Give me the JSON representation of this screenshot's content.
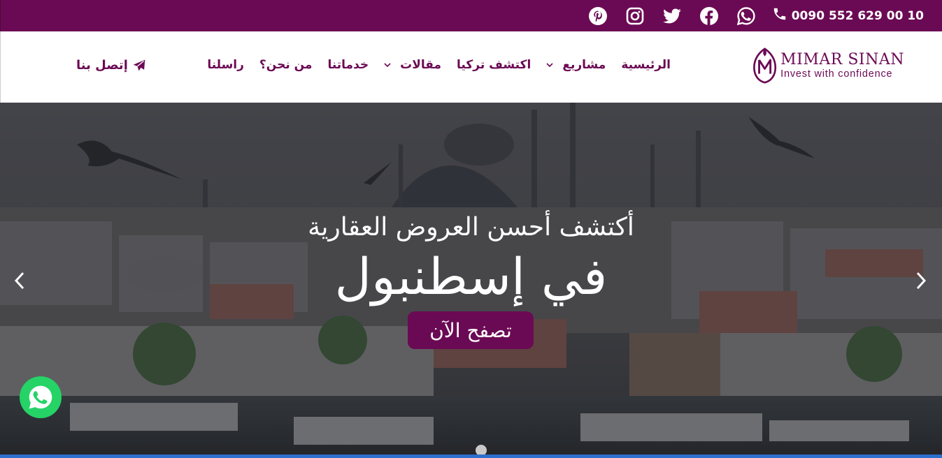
{
  "topbar": {
    "phone": "0090 552 629 00 10",
    "social_icons": [
      "whatsapp-icon",
      "facebook-icon",
      "twitter-icon",
      "instagram-icon",
      "pinterest-icon"
    ],
    "bg_color": "#6b0a54"
  },
  "logo": {
    "name": "MIMAR SINAN",
    "tagline": "Invest with confidence"
  },
  "nav": {
    "items": [
      {
        "label": "الرئيسية",
        "dropdown": false
      },
      {
        "label": "مشاريع",
        "dropdown": true
      },
      {
        "label": "اكتشف تركيا",
        "dropdown": false
      },
      {
        "label": "مقالات",
        "dropdown": true
      },
      {
        "label": "خدماتنا",
        "dropdown": false
      },
      {
        "label": "من نحن؟",
        "dropdown": false
      },
      {
        "label": "راسلنا",
        "dropdown": false
      }
    ],
    "contact_label": "إتصل بنا"
  },
  "hero": {
    "line1": "أكتشف أحسن العروض العقارية",
    "line2": "في إسطنبول",
    "cta_label": "تصفح الآن",
    "slide_count": 1,
    "active_slide": 1
  },
  "colors": {
    "brand": "#6b0a54",
    "whatsapp": "#25d366",
    "bottom_bar": "#2d6fcf"
  }
}
